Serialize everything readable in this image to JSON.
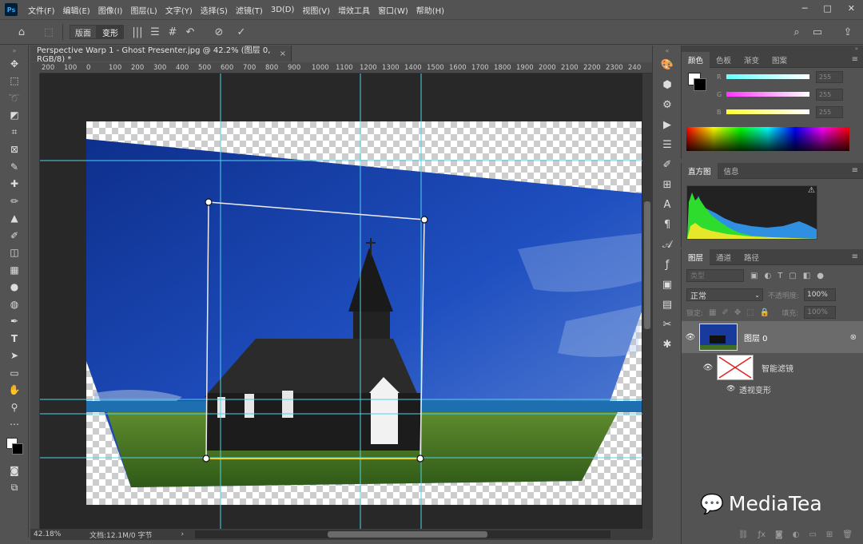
{
  "app": {
    "logo": "Ps",
    "menus": [
      "文件(F)",
      "编辑(E)",
      "图像(I)",
      "图层(L)",
      "文字(Y)",
      "选择(S)",
      "滤镜(T)",
      "3D(D)",
      "视图(V)",
      "增效工具",
      "窗口(W)",
      "帮助(H)"
    ],
    "win_minimize": "─",
    "win_restore": "□",
    "win_close": "✕"
  },
  "options": {
    "tab_layout": "版面",
    "tab_warp": "变形"
  },
  "document": {
    "tab_title": "Perspective Warp 1 - Ghost Presenter.jpg @ 42.2% (图层 0, RGB/8) *",
    "tab_close": "×",
    "ruler_ticks": [
      "200",
      "100",
      "0",
      "100",
      "200",
      "300",
      "400",
      "500",
      "600",
      "700",
      "800",
      "900",
      "1000",
      "1100",
      "1200",
      "1300",
      "1400",
      "1500",
      "1600",
      "1700",
      "1800",
      "1900",
      "2000",
      "2100",
      "2200",
      "2300",
      "240"
    ]
  },
  "status": {
    "zoom": "42.18%",
    "doc_size": "文档:12.1M/0 字节",
    "arrow": "›"
  },
  "color_panel": {
    "tabs": [
      "颜色",
      "色板",
      "渐变",
      "图案"
    ],
    "channels": [
      {
        "label": "R",
        "value": "255"
      },
      {
        "label": "G",
        "value": "255"
      },
      {
        "label": "B",
        "value": "255"
      }
    ]
  },
  "histogram_panel": {
    "tabs": [
      "直方图",
      "信息"
    ],
    "warning": "⚠"
  },
  "layers_panel": {
    "tabs": [
      "图层",
      "通道",
      "路径"
    ],
    "search_placeholder": "类型",
    "blend_mode": "正常",
    "opacity_label": "不透明度:",
    "opacity_value": "100%",
    "lock_label": "锁定:",
    "fill_label": "填充:",
    "fill_value": "100%",
    "layers": [
      {
        "name": "图层 0"
      },
      {
        "name": "智能滤镜"
      },
      {
        "name": "透视变形"
      }
    ]
  },
  "watermark": {
    "text": "MediaTea"
  },
  "colors": {
    "guide": "#4fd3e8",
    "accent_line": "#f2d21b"
  }
}
